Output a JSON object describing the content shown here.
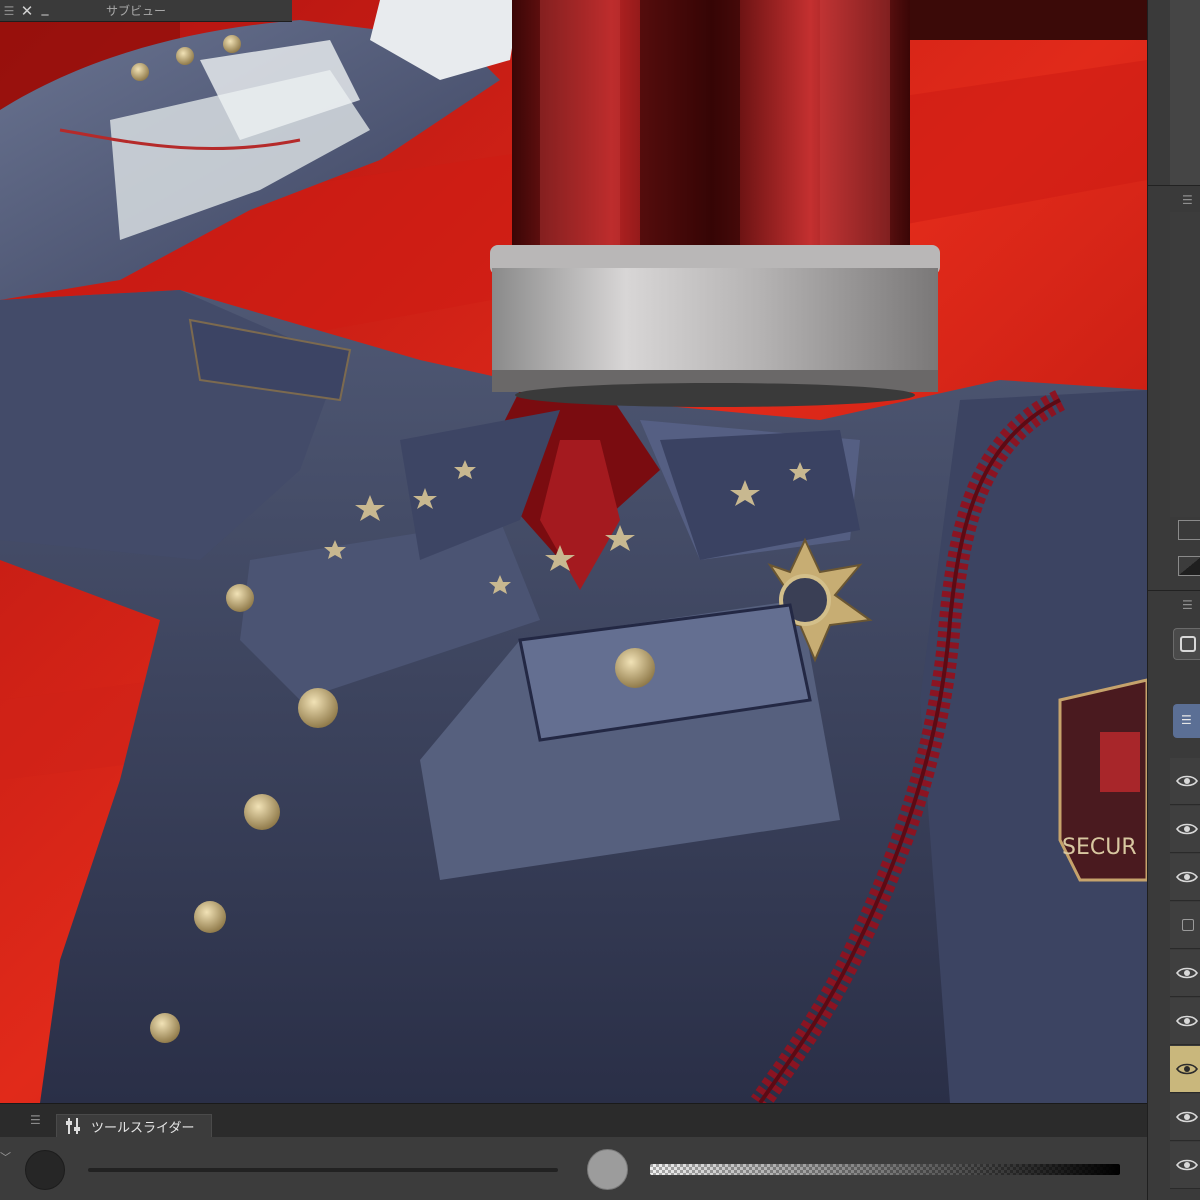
{
  "subview": {
    "title": "サブビュー",
    "menu_icon": "hamburger-icon",
    "close_icon": "close-icon",
    "minimize_icon": "minimize-icon"
  },
  "tool_slider_panel": {
    "tab_label": "ツールスライダー",
    "tab_icon": "tool-slider-icon",
    "menu_icon": "hamburger-icon",
    "collapse_icon": "chevron-down-icon",
    "brush_opacity": 1.0
  },
  "canvas": {
    "badge_text": "SECUR"
  },
  "layers": {
    "rows": [
      {
        "visible": true,
        "active": false
      },
      {
        "visible": true,
        "active": false
      },
      {
        "visible": true,
        "active": false
      },
      {
        "visible": false,
        "active": false
      },
      {
        "visible": true,
        "active": false
      },
      {
        "visible": true,
        "active": false
      },
      {
        "visible": true,
        "active": true
      },
      {
        "visible": true,
        "active": false
      },
      {
        "visible": true,
        "active": false
      }
    ]
  },
  "colors": {
    "active_layer": "#c9b77c",
    "panel_bg": "#3c3c3c",
    "canvas_red": "#c4150f"
  }
}
